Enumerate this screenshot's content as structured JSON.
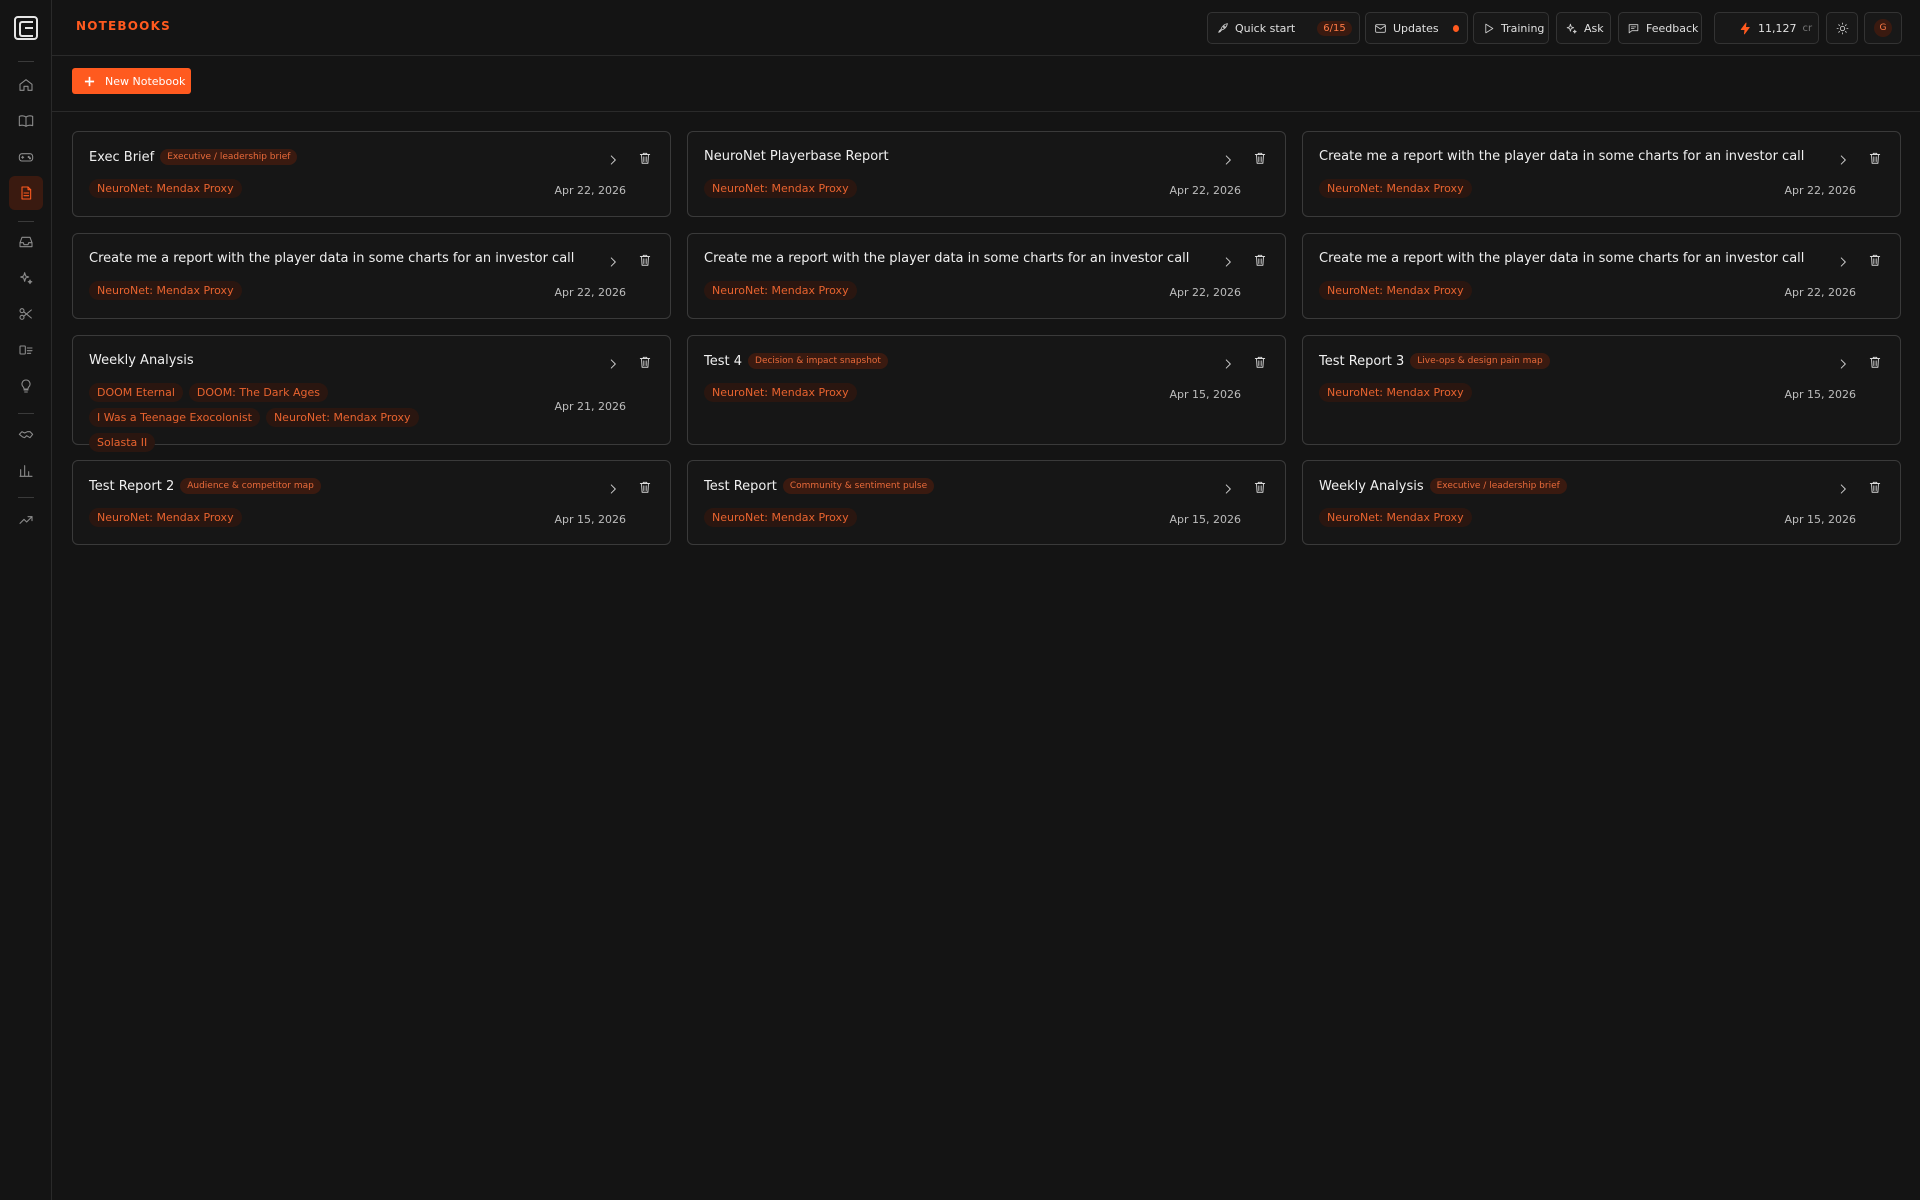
{
  "header": {
    "title": "NOTEBOOKS",
    "quick_start_label": "Quick start",
    "quick_start_progress": "6/15",
    "updates_label": "Updates",
    "training_label": "Training",
    "ask_label": "Ask",
    "feedback_label": "Feedback",
    "credits_value": "11,127",
    "credits_unit": "cr",
    "avatar_initial": "G"
  },
  "toolbar": {
    "new_notebook_label": "New Notebook"
  },
  "colors": {
    "accent": "#ff5a1f",
    "background": "#141414",
    "tag_bg": "#2a1610"
  },
  "sidebar": {
    "items": [
      {
        "icon": "home-icon"
      },
      {
        "icon": "book-icon"
      },
      {
        "icon": "gamepad-icon"
      },
      {
        "icon": "notebook-icon",
        "active": true
      },
      {
        "icon": "inbox-icon"
      },
      {
        "icon": "sparkles-icon"
      },
      {
        "icon": "scissors-icon"
      },
      {
        "icon": "id-card-icon"
      },
      {
        "icon": "lightbulb-icon"
      },
      {
        "icon": "handshake-icon"
      },
      {
        "icon": "bar-chart-icon"
      },
      {
        "icon": "trending-icon"
      }
    ]
  },
  "notebooks": [
    {
      "title": "Exec Brief",
      "template": "Executive / leadership brief",
      "tags": [
        "NeuroNet: Mendax Proxy"
      ],
      "date": "Apr 22, 2026"
    },
    {
      "title": "NeuroNet Playerbase Report",
      "template": "",
      "tags": [
        "NeuroNet: Mendax Proxy"
      ],
      "date": "Apr 22, 2026"
    },
    {
      "title": "Create me a report with the player data in some charts for an investor call",
      "template": "",
      "tags": [
        "NeuroNet: Mendax Proxy"
      ],
      "date": "Apr 22, 2026"
    },
    {
      "title": "Create me a report with the player data in some charts for an investor call",
      "template": "",
      "tags": [
        "NeuroNet: Mendax Proxy"
      ],
      "date": "Apr 22, 2026"
    },
    {
      "title": "Create me a report with the player data in some charts for an investor call",
      "template": "",
      "tags": [
        "NeuroNet: Mendax Proxy"
      ],
      "date": "Apr 22, 2026"
    },
    {
      "title": "Create me a report with the player data in some charts for an investor call",
      "template": "",
      "tags": [
        "NeuroNet: Mendax Proxy"
      ],
      "date": "Apr 22, 2026"
    },
    {
      "title": "Weekly Analysis",
      "template": "",
      "tags": [
        "DOOM Eternal",
        "DOOM: The Dark Ages",
        "I Was a Teenage Exocolonist",
        "NeuroNet: Mendax Proxy",
        "Solasta II"
      ],
      "date": "Apr 21, 2026"
    },
    {
      "title": "Test 4",
      "template": "Decision & impact snapshot",
      "tags": [
        "NeuroNet: Mendax Proxy"
      ],
      "date": "Apr 15, 2026"
    },
    {
      "title": "Test Report 3",
      "template": "Live-ops & design pain map",
      "tags": [
        "NeuroNet: Mendax Proxy"
      ],
      "date": "Apr 15, 2026"
    },
    {
      "title": "Test Report 2",
      "template": "Audience & competitor map",
      "tags": [
        "NeuroNet: Mendax Proxy"
      ],
      "date": "Apr 15, 2026"
    },
    {
      "title": "Test Report",
      "template": "Community & sentiment pulse",
      "tags": [
        "NeuroNet: Mendax Proxy"
      ],
      "date": "Apr 15, 2026"
    },
    {
      "title": "Weekly Analysis",
      "template": "Executive / leadership brief",
      "tags": [
        "NeuroNet: Mendax Proxy"
      ],
      "date": "Apr 15, 2026"
    }
  ]
}
